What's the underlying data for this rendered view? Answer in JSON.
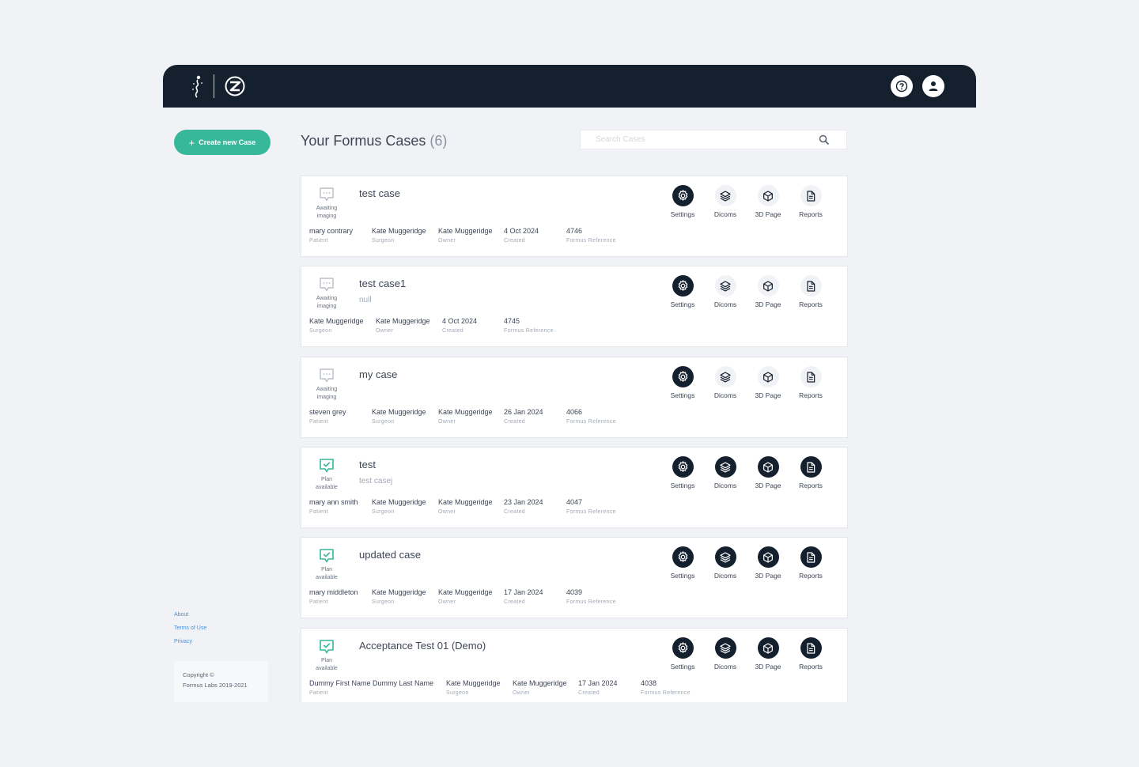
{
  "header": {
    "help_icon": "help-circle-icon",
    "account_icon": "user-icon"
  },
  "create_button": {
    "icon": "plus-icon",
    "label": "Create new Case"
  },
  "page": {
    "title": "Your Formus Cases",
    "count": "(6)"
  },
  "search": {
    "placeholder": "Search Cases",
    "value": "",
    "icon": "search-icon"
  },
  "footer": {
    "links": [
      "About",
      "Terms of Use",
      "Privacy"
    ],
    "copyright_line1": "Copyright ©",
    "copyright_line2": "Formus Labs 2019-2021"
  },
  "action_labels": {
    "settings": "Settings",
    "dicoms": "Dicoms",
    "page3d": "3D Page",
    "reports": "Reports"
  },
  "cases": [
    {
      "title": "test case",
      "subtitle": "",
      "status": "Awaiting imaging",
      "status_line1": "Awaiting",
      "status_line2": "imaging",
      "dicoms_active": false,
      "fields": [
        {
          "value": "mary contrary",
          "label": "Patient"
        },
        {
          "value": "Kate Muggeridge",
          "label": "Surgeon"
        },
        {
          "value": "Kate Muggeridge",
          "label": "Owner"
        },
        {
          "value": "4 Oct 2024",
          "label": "Created"
        },
        {
          "value": "4746",
          "label": "Formus Reference"
        }
      ]
    },
    {
      "title": "test case1",
      "subtitle": "null",
      "status": "Awaiting imaging",
      "status_line1": "Awaiting",
      "status_line2": "imaging",
      "dicoms_active": false,
      "fields": [
        {
          "value": "Kate Muggeridge",
          "label": "Surgeon"
        },
        {
          "value": "Kate Muggeridge",
          "label": "Owner"
        },
        {
          "value": "4 Oct 2024",
          "label": "Created"
        },
        {
          "value": "4745",
          "label": "Formus Reference"
        }
      ]
    },
    {
      "title": "my case",
      "subtitle": "",
      "status": "Awaiting imaging",
      "status_line1": "Awaiting",
      "status_line2": "imaging",
      "dicoms_active": false,
      "fields": [
        {
          "value": "steven grey",
          "label": "Patient"
        },
        {
          "value": "Kate Muggeridge",
          "label": "Surgeon"
        },
        {
          "value": "Kate Muggeridge",
          "label": "Owner"
        },
        {
          "value": "26 Jan 2024",
          "label": "Created"
        },
        {
          "value": "4066",
          "label": "Formus Reference"
        }
      ]
    },
    {
      "title": "test",
      "subtitle": "test casej",
      "status": "Plan available",
      "status_line1": "Plan",
      "status_line2": "available",
      "dicoms_active": true,
      "fields": [
        {
          "value": "mary ann smith",
          "label": "Patient"
        },
        {
          "value": "Kate Muggeridge",
          "label": "Surgeon"
        },
        {
          "value": "Kate Muggeridge",
          "label": "Owner"
        },
        {
          "value": "23 Jan 2024",
          "label": "Created"
        },
        {
          "value": "4047",
          "label": "Formus Reference"
        }
      ]
    },
    {
      "title": "updated case",
      "subtitle": "",
      "status": "Plan available",
      "status_line1": "Plan",
      "status_line2": "available",
      "dicoms_active": true,
      "fields": [
        {
          "value": "mary middleton",
          "label": "Patient"
        },
        {
          "value": "Kate Muggeridge",
          "label": "Surgeon"
        },
        {
          "value": "Kate Muggeridge",
          "label": "Owner"
        },
        {
          "value": "17 Jan 2024",
          "label": "Created"
        },
        {
          "value": "4039",
          "label": "Formus Reference"
        }
      ]
    },
    {
      "title": "Acceptance Test 01 (Demo)",
      "subtitle": "",
      "status": "Plan available",
      "status_line1": "Plan",
      "status_line2": "available",
      "dicoms_active": true,
      "fields": [
        {
          "value": "Dummy First Name Dummy Last Name",
          "label": "Patient"
        },
        {
          "value": "Kate Muggeridge",
          "label": "Surgeon"
        },
        {
          "value": "Kate Muggeridge",
          "label": "Owner"
        },
        {
          "value": "17 Jan 2024",
          "label": "Created"
        },
        {
          "value": "4038",
          "label": "Formus Reference"
        }
      ]
    }
  ],
  "colors": {
    "header_bg": "#15202e",
    "accent_green": "#37b89a",
    "link_blue": "#4a90d9",
    "icon_dark": "#15202e",
    "icon_inactive_bg": "#f1f2f5"
  }
}
